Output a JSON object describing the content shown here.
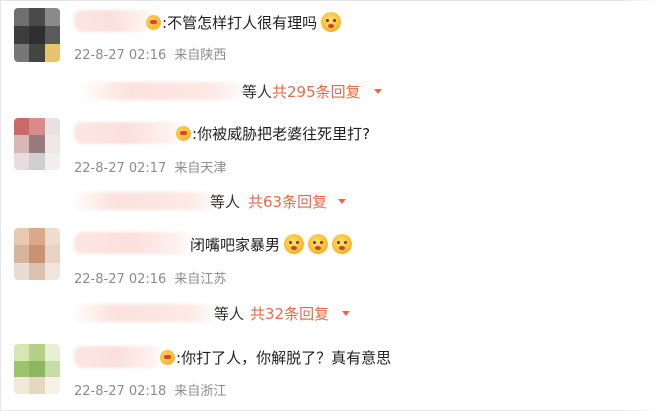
{
  "comments": [
    {
      "text": "不管怎样打人很有理吗",
      "time": "22-8-27 02:16",
      "location": "来自陕西",
      "reply_tail": "等人",
      "reply_count": "共295条回复"
    },
    {
      "text": "你被威胁把老婆往死里打?",
      "time": "22-8-27 02:17",
      "location": "来自天津",
      "reply_tail": "等人",
      "reply_count": "共63条回复"
    },
    {
      "text": "闭嘴吧家暴男",
      "time": "22-8-27 02:16",
      "location": "来自江苏",
      "reply_tail": "等人",
      "reply_count": "共32条回复"
    },
    {
      "text": "你打了人，你解脱了？真有意思",
      "time": "22-8-27 02:18",
      "location": "来自浙江"
    }
  ],
  "icons": {
    "badge": "vip-badge-icon",
    "emoji": "surprised-face-emoji-icon",
    "expand": "caret-down-icon"
  },
  "colors": {
    "reply_accent": "#e86a45",
    "meta_gray": "#8c8c8c"
  }
}
